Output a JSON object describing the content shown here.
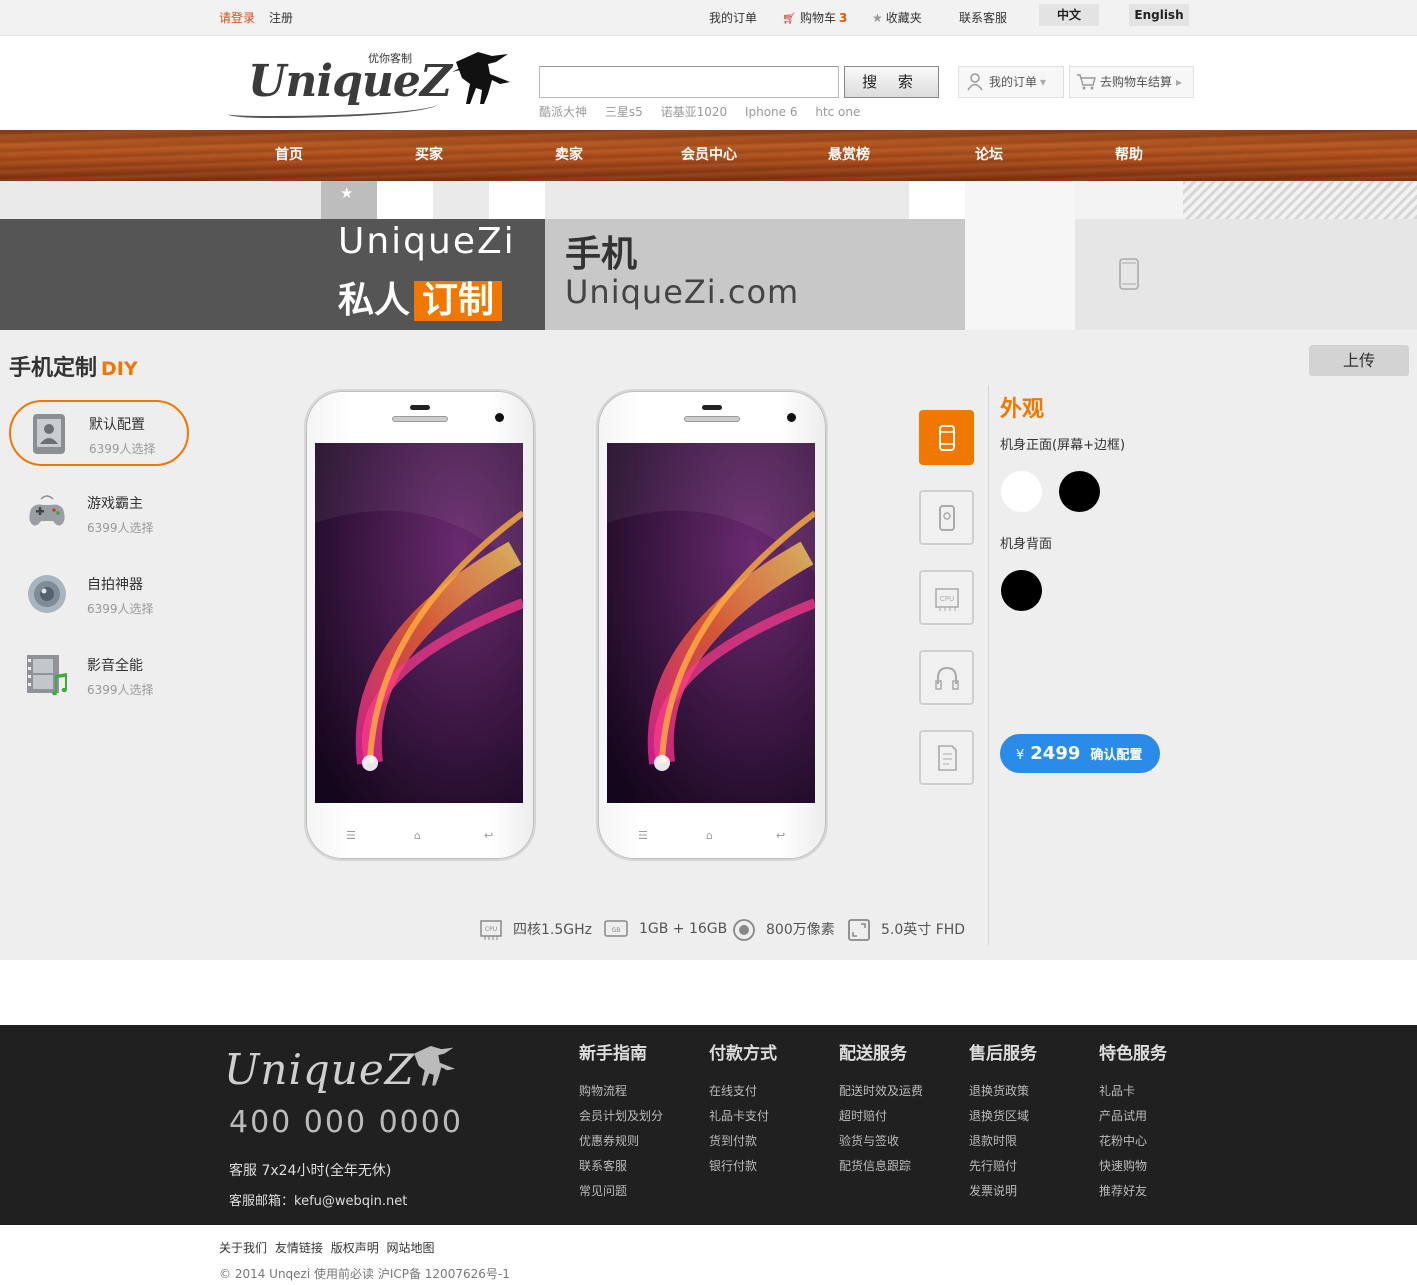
{
  "topbar": {
    "login": "请登录",
    "register": "注册",
    "my_orders": "我的订单",
    "cart_label": "购物车",
    "cart_count": "3",
    "favorites": "收藏夹",
    "customer_service": "联系客服",
    "lang_cn": "中文",
    "lang_en": "English"
  },
  "header": {
    "logo_text": "UniqueZ",
    "logo_cn": "优你客制",
    "search_placeholder": "",
    "search_button": "搜 索",
    "hot_words": [
      "酷派大神",
      "三星s5",
      "诺基亚1020",
      "Iphone 6",
      "htc one"
    ],
    "my_orders_box": "我的订单",
    "checkout_box": "去购物车结算"
  },
  "nav": {
    "items": [
      "首页",
      "买家",
      "卖家",
      "会员中心",
      "悬赏榜",
      "论坛",
      "帮助"
    ]
  },
  "banner": {
    "title1": "UniqueZi",
    "title2_a": "私人",
    "title2_b": "订制",
    "phone_label": "手机",
    "url": "UniqueZi.com"
  },
  "diy": {
    "title": "手机定制",
    "title_suffix": "DIY",
    "presets": [
      {
        "name": "默认配置",
        "count": "6399人选择"
      },
      {
        "name": "游戏霸主",
        "count": "6399人选择"
      },
      {
        "name": "自拍神器",
        "count": "6399人选择"
      },
      {
        "name": "影音全能",
        "count": "6399人选择"
      }
    ],
    "upload": "上传",
    "look_title": "外观",
    "front_label": "机身正面(屏幕+边框)",
    "back_label": "机身背面",
    "price_symbol": "¥",
    "price": "2499",
    "confirm": "确认配置",
    "specs": [
      "四核1.5GHz",
      "1GB + 16GB",
      "800万像素",
      "5.0英寸 FHD"
    ],
    "colors": {
      "accent": "#f07800",
      "confirm": "#2a8ce8"
    }
  },
  "footer": {
    "logo": "UniqueZ",
    "phone": "400 000 0000",
    "hours": "客服 7x24小时(全年无休)",
    "email": "客服邮箱：kefu@webqin.net",
    "columns": [
      {
        "title": "新手指南",
        "links": [
          "购物流程",
          "会员计划及划分",
          "优惠券规则",
          "联系客服",
          "常见问题"
        ]
      },
      {
        "title": "付款方式",
        "links": [
          "在线支付",
          "礼品卡支付",
          "货到付款",
          "银行付款"
        ]
      },
      {
        "title": "配送服务",
        "links": [
          "配送时效及运费",
          "超时赔付",
          "验货与签收",
          "配货信息跟踪"
        ]
      },
      {
        "title": "售后服务",
        "links": [
          "退换货政策",
          "退换货区域",
          "退款时限",
          "先行赔付",
          "发票说明"
        ]
      },
      {
        "title": "特色服务",
        "links": [
          "礼品卡",
          "产品试用",
          "花粉中心",
          "快速购物",
          "推荐好友"
        ]
      }
    ],
    "bottom_links": [
      "关于我们",
      "友情链接",
      "版权声明",
      "网站地图"
    ],
    "copyright": "© 2014 Unqezi 使用前必读 沪ICP备 12007626号-1"
  }
}
